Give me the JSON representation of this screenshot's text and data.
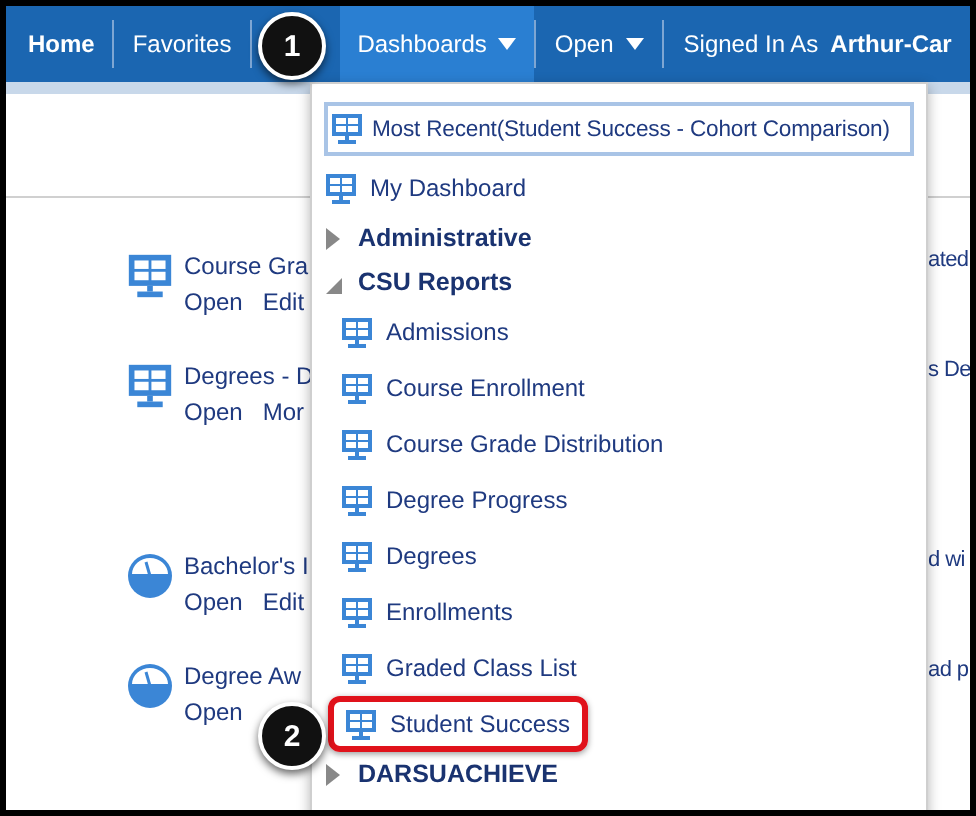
{
  "nav": [
    {
      "label": "Home",
      "kind": "home",
      "selected": false,
      "has_menu": false
    },
    {
      "label": "Favorites",
      "kind": "link",
      "selected": false,
      "has_menu": false
    },
    {
      "label": "Dashboards",
      "kind": "link",
      "selected": true,
      "has_menu": true
    },
    {
      "label": "Open",
      "kind": "link",
      "selected": false,
      "has_menu": true
    }
  ],
  "signed_in": {
    "label": "Signed In As",
    "user": "Arthur-Car"
  },
  "cards": [
    {
      "kind": "dashboard",
      "title": "Course Gra",
      "actions": [
        "Open",
        "Edit"
      ],
      "trailing_text": "ated"
    },
    {
      "kind": "dashboard",
      "title": "Degrees - D",
      "actions": [
        "Open",
        "Mor"
      ],
      "trailing_text": "s De"
    },
    {
      "kind": "analysis",
      "title": "Bachelor's I",
      "actions": [
        "Open",
        "Edit"
      ],
      "trailing_text": "d wi"
    },
    {
      "kind": "analysis",
      "title": "Degree Aw",
      "actions": [
        "Open"
      ],
      "trailing_text": "ad p"
    }
  ],
  "menu": {
    "recent": "Most Recent(Student Success - Cohort Comparison)",
    "items": [
      {
        "kind": "dashboard",
        "label": "My Dashboard",
        "highlighted": false
      },
      {
        "kind": "folder",
        "label": "Administrative",
        "expanded": false
      },
      {
        "kind": "folder",
        "label": "CSU Reports",
        "expanded": true,
        "children": [
          {
            "kind": "dashboard",
            "label": "Admissions",
            "highlighted": false
          },
          {
            "kind": "dashboard",
            "label": "Course Enrollment",
            "highlighted": false
          },
          {
            "kind": "dashboard",
            "label": "Course Grade Distribution",
            "highlighted": false
          },
          {
            "kind": "dashboard",
            "label": "Degree Progress",
            "highlighted": false
          },
          {
            "kind": "dashboard",
            "label": "Degrees",
            "highlighted": false
          },
          {
            "kind": "dashboard",
            "label": "Enrollments",
            "highlighted": false
          },
          {
            "kind": "dashboard",
            "label": "Graded Class List",
            "highlighted": false
          },
          {
            "kind": "dashboard",
            "label": "Student Success",
            "highlighted": true
          }
        ]
      },
      {
        "kind": "folder",
        "label": "DARSUACHIEVE",
        "expanded": false
      }
    ]
  },
  "callouts": [
    {
      "number": "1"
    },
    {
      "number": "2"
    }
  ]
}
